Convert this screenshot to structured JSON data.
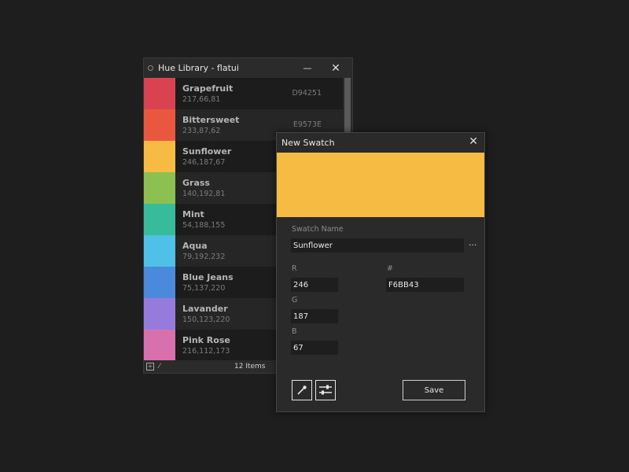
{
  "library": {
    "title": "Hue Library - flatui",
    "minimize_glyph": "—",
    "close_glyph": "✕",
    "footer": {
      "count": "12 Items"
    },
    "swatches": [
      {
        "name": "Grapefruit",
        "rgb": "217,66,81",
        "hex": "D94251",
        "color": "#d94251"
      },
      {
        "name": "Bittersweet",
        "rgb": "233,87,62",
        "hex": "E9573E",
        "color": "#e9573e"
      },
      {
        "name": "Sunflower",
        "rgb": "246,187,67",
        "hex": "",
        "color": "#f6bb43"
      },
      {
        "name": "Grass",
        "rgb": "140,192,81",
        "hex": "",
        "color": "#8cc051"
      },
      {
        "name": "Mint",
        "rgb": "54,188,155",
        "hex": "",
        "color": "#36bc9b"
      },
      {
        "name": "Aqua",
        "rgb": "79,192,232",
        "hex": "",
        "color": "#4fc0e8"
      },
      {
        "name": "Blue Jeans",
        "rgb": "75,137,220",
        "hex": "",
        "color": "#4b89dc"
      },
      {
        "name": "Lavander",
        "rgb": "150,123,220",
        "hex": "",
        "color": "#967bdc"
      },
      {
        "name": "Pink Rose",
        "rgb": "216,112,173",
        "hex": "",
        "color": "#d870ad"
      }
    ]
  },
  "dialog": {
    "title": "New Swatch",
    "close_glyph": "✕",
    "preview_color": "#f6bb43",
    "name_label": "Swatch Name",
    "name_value": "Sunflower",
    "more_glyph": "···",
    "r_label": "R",
    "r_value": "246",
    "g_label": "G",
    "g_value": "187",
    "b_label": "B",
    "b_value": "67",
    "hex_label": "#",
    "hex_value": "F6BB43",
    "save_label": "Save"
  }
}
